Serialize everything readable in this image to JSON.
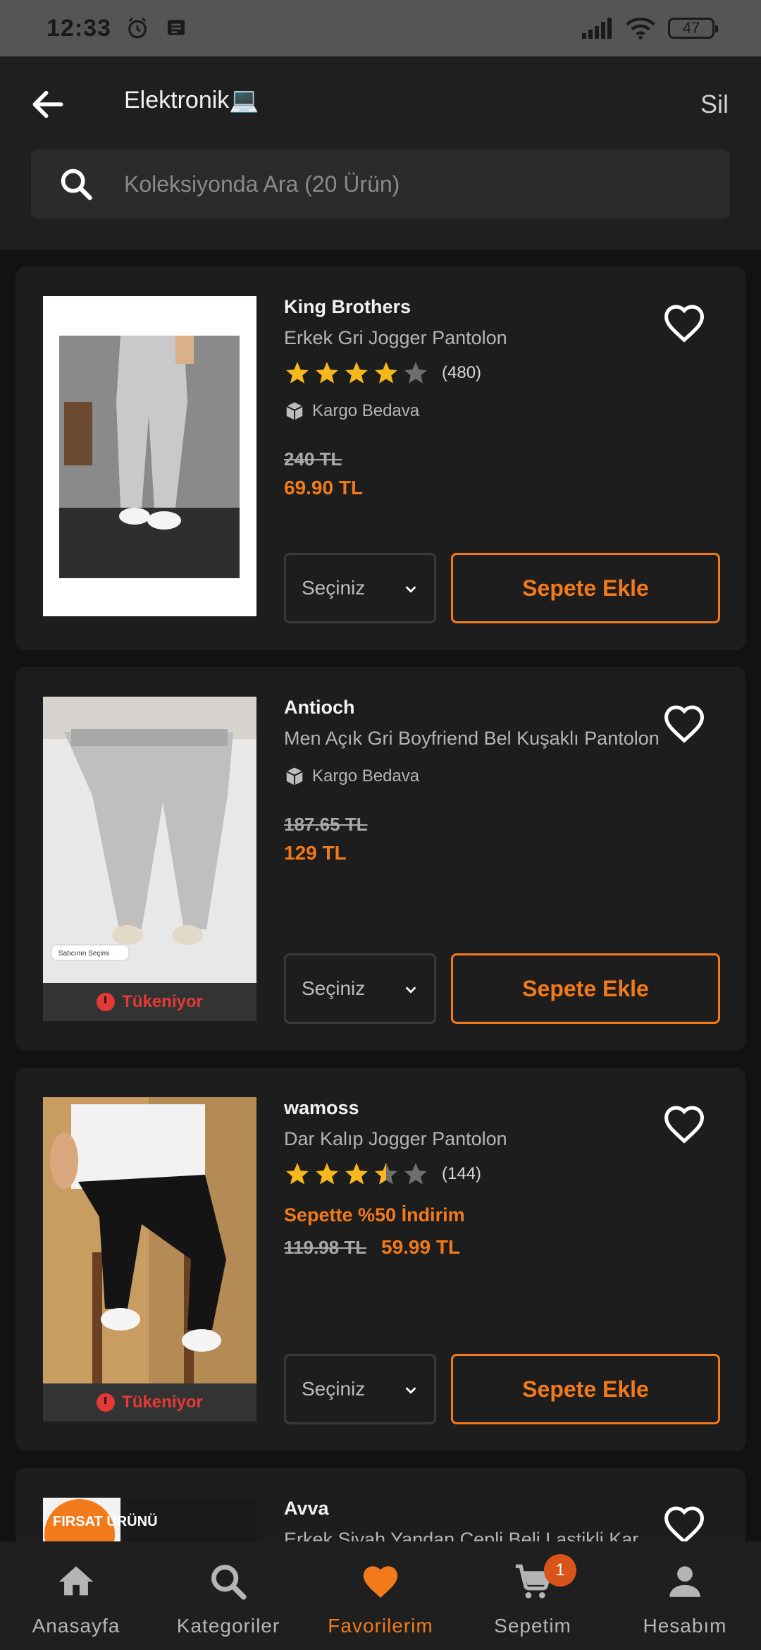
{
  "status_bar": {
    "time": "12:33",
    "battery": "47"
  },
  "header": {
    "title": "Elektronik💻",
    "delete_label": "Sil",
    "search_placeholder": "Koleksiyonda Ara (20 Ürün)"
  },
  "products": [
    {
      "brand": "King Brothers",
      "name": "Erkek Gri Jogger Pantolon",
      "rating": 4,
      "review_count": "(480)",
      "shipping": "Kargo Bedava",
      "old_price": "240 TL",
      "price": "69.90 TL",
      "select_label": "Seçiniz",
      "add_label": "Sepete Ekle"
    },
    {
      "brand": "Antioch",
      "name": "Men Açık Gri Boyfriend Bel Kuşaklı Pantolon",
      "shipping": "Kargo Bedava",
      "old_price": "187.65 TL",
      "price": "129 TL",
      "badge": "Satıcının Seçimi",
      "stock_label": "Tükeniyor",
      "select_label": "Seçiniz",
      "add_label": "Sepete Ekle"
    },
    {
      "brand": "wamoss",
      "name": "Dar Kalıp Jogger Pantolon",
      "rating": 3.5,
      "review_count": "(144)",
      "promo": "Sepette %50 İndirim",
      "old_price": "119.98 TL",
      "price": "59.99 TL",
      "stock_label": "Tükeniyor",
      "select_label": "Seçiniz",
      "add_label": "Sepete Ekle"
    },
    {
      "brand": "Avva",
      "name": "Erkek Siyah Yandan Cepli Beli Lastikli Kargo Pantolon",
      "badge": "FIRSAT ÜRÜNÜ"
    }
  ],
  "bottom_nav": [
    {
      "label": "Anasayfa",
      "icon": "home-icon"
    },
    {
      "label": "Kategoriler",
      "icon": "search-icon"
    },
    {
      "label": "Favorilerim",
      "icon": "heart-icon",
      "active": true
    },
    {
      "label": "Sepetim",
      "icon": "cart-icon",
      "badge": "1"
    },
    {
      "label": "Hesabım",
      "icon": "account-icon"
    }
  ],
  "colors": {
    "accent": "#f27a1a",
    "danger": "#e53935",
    "star": "#f6b81c"
  }
}
